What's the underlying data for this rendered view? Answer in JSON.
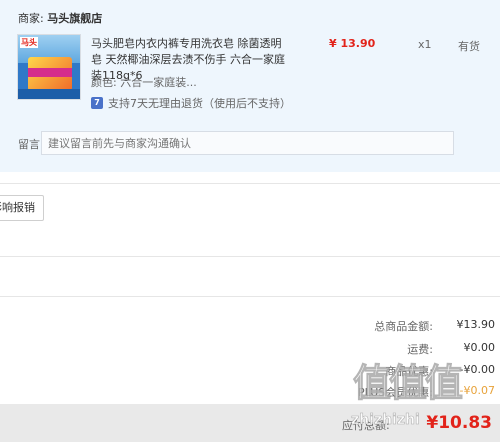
{
  "merchant": {
    "label": "商家:",
    "name": "马头旗舰店"
  },
  "item": {
    "image_brand": "马头",
    "title": "马头肥皂内衣内裤专用洗衣皂 除菌透明皂 天然椰油深层去渍不伤手 六合一家庭装118g*6",
    "price": "¥ 13.90",
    "quantity": "x1",
    "stock_status": "有货",
    "color_label": "颜色:",
    "color_value": "六合一家庭装...",
    "return_icon": "7",
    "return_policy": "支持7天无理由退货（使用后不支持）"
  },
  "remark": {
    "label": "留言:",
    "placeholder": "建议留言前先与商家沟通确认"
  },
  "invoice": {
    "button_label": "影响报销"
  },
  "summary": [
    {
      "label": "总商品金额:",
      "value": "¥13.90"
    },
    {
      "label": "运费:",
      "value": "¥0.00"
    },
    {
      "label": "商品优惠:",
      "value": "-¥0.00"
    },
    {
      "label": "PLUS会员优惠:",
      "value": "-¥0.07"
    }
  ],
  "footer": {
    "label": "应付总额:",
    "total": "¥10.83"
  },
  "watermark": {
    "glyphs": "值值值",
    "text": "zhizhizhi"
  },
  "colors": {
    "price_red": "#e2231a",
    "card_bg": "#eef6fd",
    "discount_orange": "#e8a33b"
  }
}
